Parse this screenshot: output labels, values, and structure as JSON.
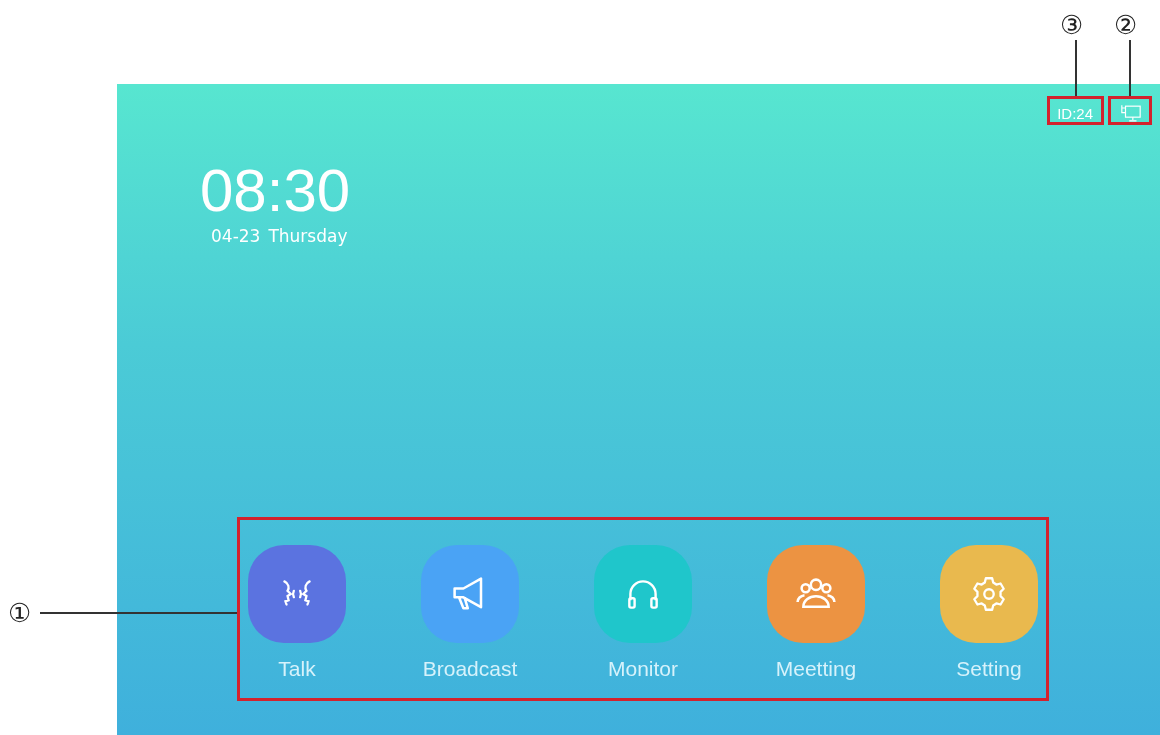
{
  "screen": {
    "time": "08:30",
    "date": "04-23",
    "weekday": "Thursday",
    "device_id": "ID:24"
  },
  "apps": [
    {
      "label": "Talk",
      "kind": "talk",
      "color": "#5b73e0"
    },
    {
      "label": "Broadcast",
      "kind": "broadcast",
      "color": "#4aa3f5"
    },
    {
      "label": "Monitor",
      "kind": "monitor",
      "color": "#1fc6cb"
    },
    {
      "label": "Meetting",
      "kind": "meeting",
      "color": "#ec9342"
    },
    {
      "label": "Setting",
      "kind": "setting",
      "color": "#e9b94e"
    }
  ],
  "callouts": {
    "apps": "①",
    "network": "②",
    "id": "③"
  }
}
